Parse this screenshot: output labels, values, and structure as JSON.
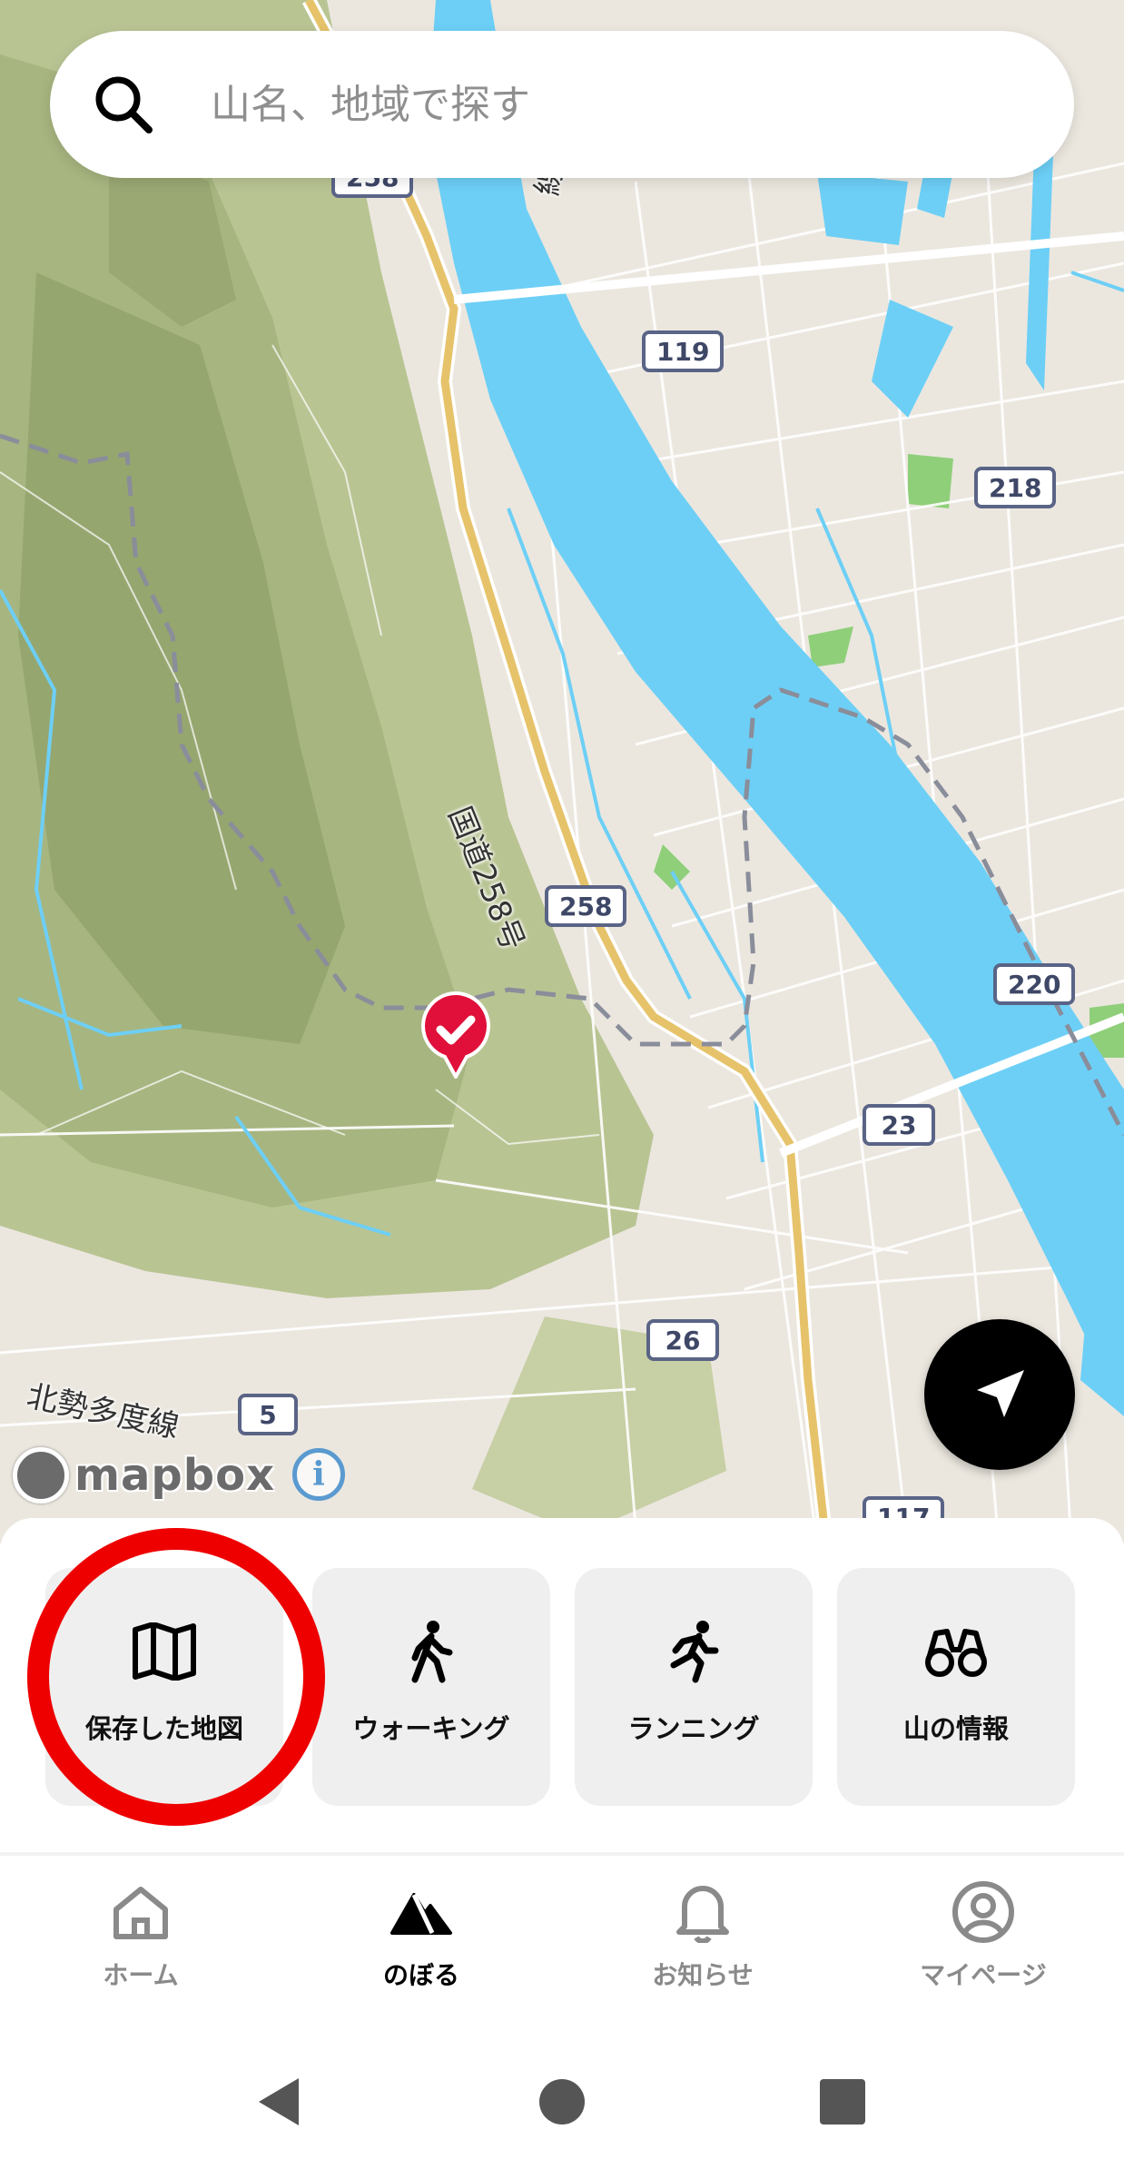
{
  "search": {
    "placeholder": "山名、地域で探す"
  },
  "map": {
    "route_shields": [
      "119",
      "218",
      "258",
      "220",
      "23",
      "26",
      "5",
      "117",
      "258"
    ],
    "labels": {
      "national_road": "国道258号",
      "prefectural_road": "北勢多度線",
      "rail_fragment": "線"
    },
    "attribution": {
      "logo_text": "mapbox",
      "info_glyph": "i"
    },
    "colors": {
      "land": "#ebe7df",
      "water": "#6dcff6",
      "forest": "#b7c28f",
      "forest_dark": "#9fae78",
      "highway": "#e6c36a",
      "boundary": "#8a8d9a",
      "marker": "#e0103a"
    },
    "marker_icon": "check-icon"
  },
  "quick_actions": [
    {
      "label": "保存した地図",
      "icon": "map-icon"
    },
    {
      "label": "ウォーキング",
      "icon": "walking-icon"
    },
    {
      "label": "ランニング",
      "icon": "running-icon"
    },
    {
      "label": "山の情報",
      "icon": "binoculars-icon"
    }
  ],
  "tabs": [
    {
      "label": "ホーム",
      "icon": "home-icon",
      "active": false
    },
    {
      "label": "のぼる",
      "icon": "mountain-icon",
      "active": true
    },
    {
      "label": "お知らせ",
      "icon": "bell-icon",
      "active": false
    },
    {
      "label": "マイページ",
      "icon": "user-icon",
      "active": false
    }
  ],
  "system_nav": [
    "back-icon",
    "home-circle-icon",
    "recents-icon"
  ],
  "annotation": {
    "color": "#ee0000",
    "target": "保存した地図"
  }
}
